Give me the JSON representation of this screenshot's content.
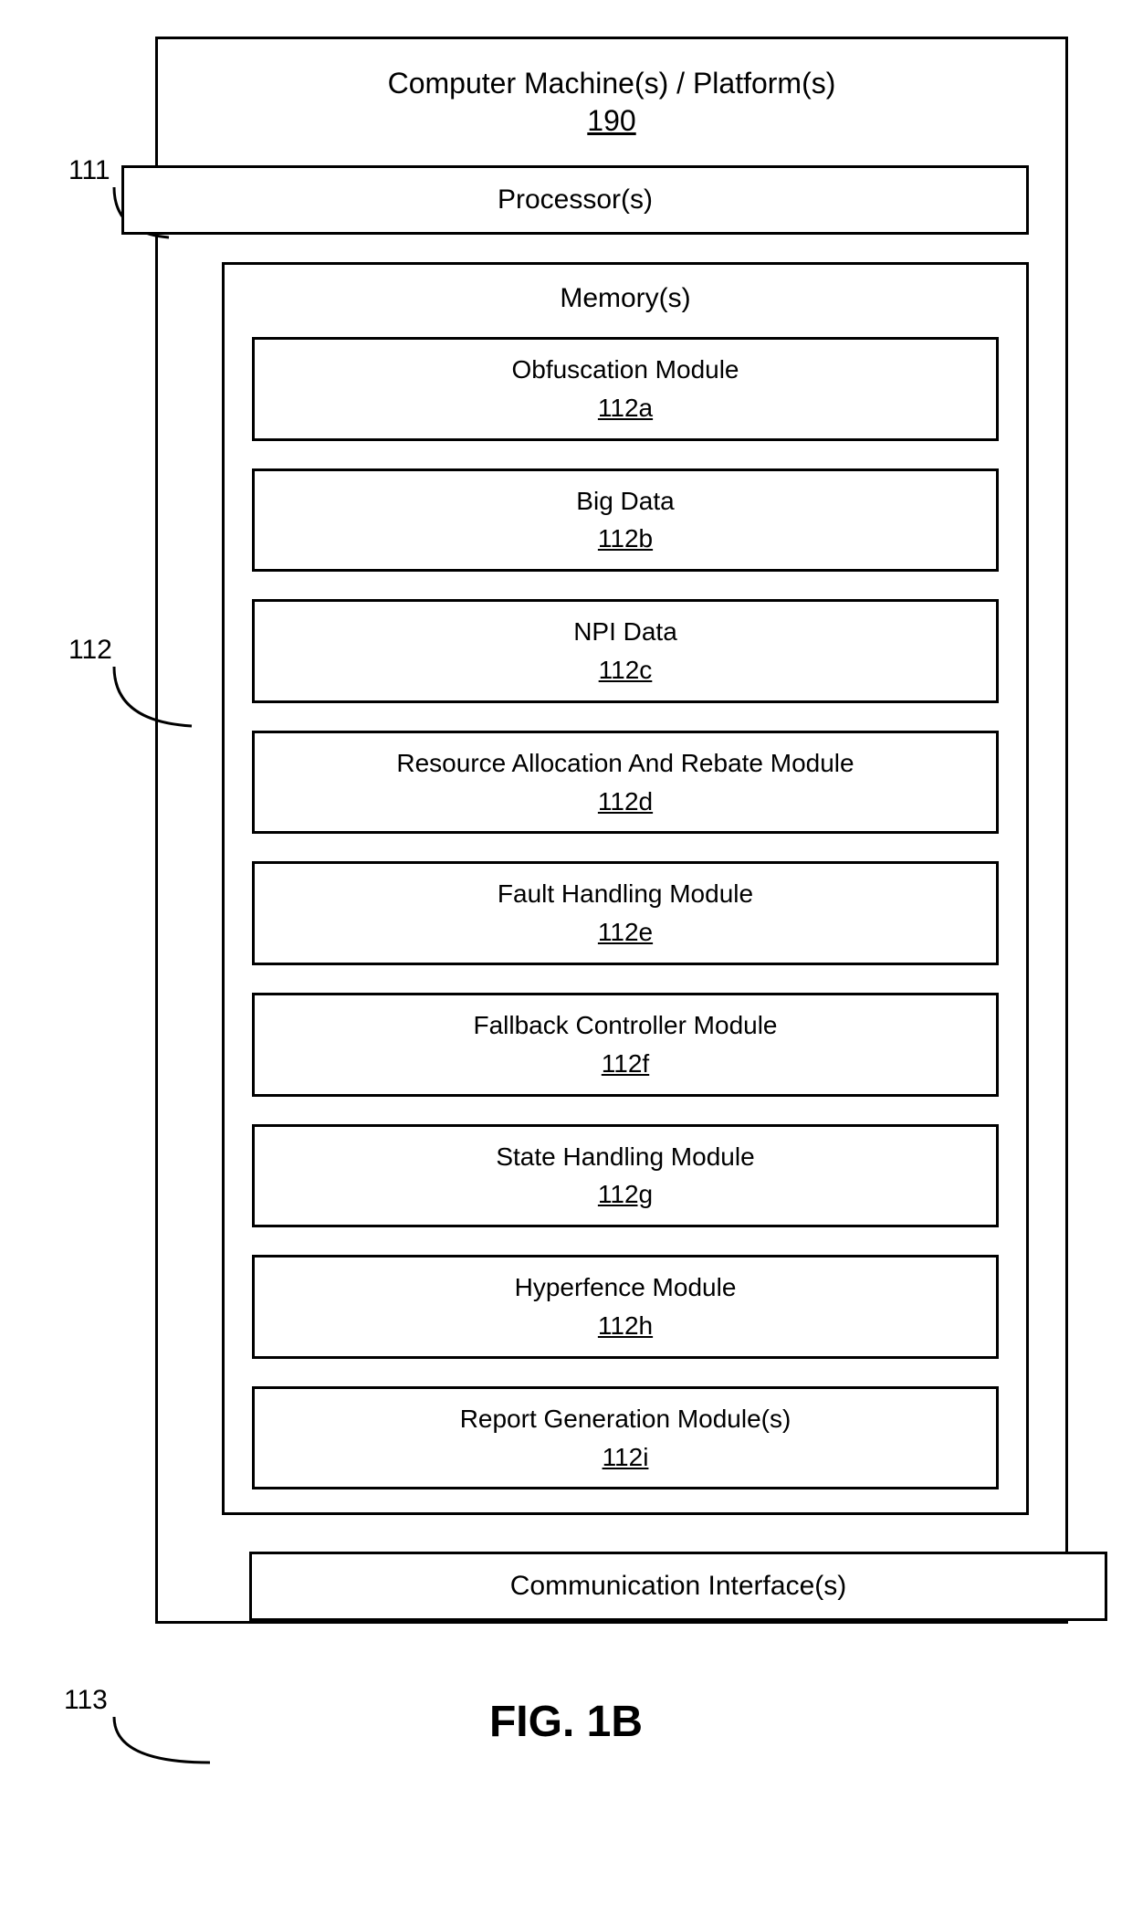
{
  "outer": {
    "title": "Computer Machine(s) / Platform(s)",
    "ref": "190"
  },
  "processor": {
    "label": "Processor(s)"
  },
  "memory": {
    "label": "Memory(s)"
  },
  "modules": [
    {
      "label": "Obfuscation Module",
      "ref": "112a"
    },
    {
      "label": "Big Data",
      "ref": "112b"
    },
    {
      "label": "NPI Data",
      "ref": "112c"
    },
    {
      "label": "Resource Allocation And Rebate Module",
      "ref": "112d"
    },
    {
      "label": "Fault Handling Module",
      "ref": "112e"
    },
    {
      "label": "Fallback Controller Module",
      "ref": "112f"
    },
    {
      "label": "State Handling Module",
      "ref": "112g"
    },
    {
      "label": "Hyperfence Module",
      "ref": "112h"
    },
    {
      "label": "Report Generation Module(s)",
      "ref": "112i"
    }
  ],
  "comm": {
    "label": "Communication Interface(s)"
  },
  "callouts": {
    "processor_ref": "111",
    "memory_ref": "112",
    "comm_ref": "113"
  },
  "figure_caption": "FIG. 1B"
}
